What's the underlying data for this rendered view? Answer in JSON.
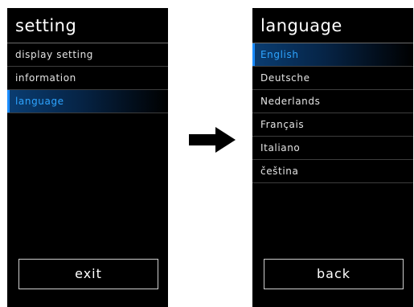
{
  "settings_screen": {
    "title": "setting",
    "items": [
      {
        "label": "display setting",
        "selected": false
      },
      {
        "label": "information",
        "selected": false
      },
      {
        "label": "language",
        "selected": true
      }
    ],
    "exit_label": "exit"
  },
  "arrow_icon": "right-arrow-icon",
  "language_screen": {
    "title": "language",
    "items": [
      {
        "label": "English",
        "selected": true
      },
      {
        "label": "Deutsche",
        "selected": false
      },
      {
        "label": "Nederlands",
        "selected": false
      },
      {
        "label": "Français",
        "selected": false
      },
      {
        "label": "Italiano",
        "selected": false
      },
      {
        "label": "čeština",
        "selected": false
      }
    ],
    "back_label": "back"
  },
  "colors": {
    "screen_background": "#000000",
    "selected_text": "#2ea4ff",
    "selected_highlight": "#0a3d72",
    "arrow": "#000000"
  }
}
